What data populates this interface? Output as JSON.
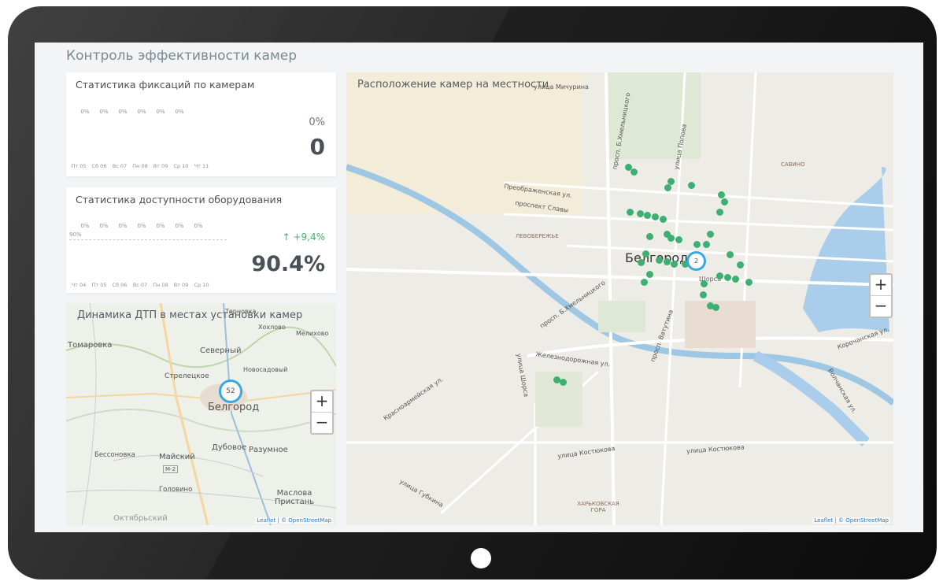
{
  "page": {
    "title": "Контроль эффективности камер"
  },
  "fixations_card": {
    "title": "Статистика фиксаций по камерам",
    "percents": [
      "0%",
      "0%",
      "0%",
      "0%",
      "0%",
      "0%"
    ],
    "days": [
      "Пт 05",
      "Сб 06",
      "Вс 07",
      "Пн 08",
      "Вт 09",
      "Ср 10",
      "Чт 11"
    ],
    "summary_pct": "0%",
    "summary_value": "0"
  },
  "availability_card": {
    "title": "Статистика доступности оборудования",
    "percents": [
      "0%",
      "0%",
      "0%",
      "0%",
      "0%",
      "0%",
      "0%"
    ],
    "baseline_label": "90%",
    "days": [
      "Чт 04",
      "Пт 05",
      "Сб 06",
      "Вс 07",
      "Пн 08",
      "Вт 09",
      "Ср 10"
    ],
    "trend": "↑ +9,4%",
    "summary_value": "90.4%"
  },
  "accidents_map": {
    "title": "Динамика ДТП в местах установки камер",
    "cluster_count": "52",
    "labels": [
      "Томаровка",
      "Северный",
      "Стрелецкое",
      "Новосадовый",
      "Белгород",
      "Бессоновка",
      "Майский",
      "М-2",
      "Дубовое",
      "Разумное",
      "Головино",
      "Маслова Пристань",
      "Октябрьский",
      "Хохлово",
      "Мелихово",
      "Терновка"
    ],
    "zoom_in": "+",
    "zoom_out": "−",
    "attribution": "Leaflet | © OpenStreetMap"
  },
  "cameras_map": {
    "title": "Расположение камер на местности",
    "cluster_count": "2",
    "labels": [
      "улица Мичурина",
      "просп. Б.Хмельницкого",
      "улица Попова",
      "Преображенская ул.",
      "проспект Славы",
      "ЛЕВОБЕРЕЖЬЕ",
      "САВИНО",
      "Белгород",
      "просп. Б.Хмельницкого",
      "Железнодорожная ул.",
      "улица Шорса",
      "Красноармейская ул.",
      "просп. Ватутина",
      "Корочанская ул.",
      "Волчанская ул.",
      "улица Костюкова",
      "улица Костюкова",
      "улица Губкина",
      "ХАРЬКОВСКАЯ ГОРА",
      "Щорса"
    ],
    "zoom_in": "+",
    "zoom_out": "−",
    "attribution": "Leaflet | © OpenStreetMap"
  }
}
